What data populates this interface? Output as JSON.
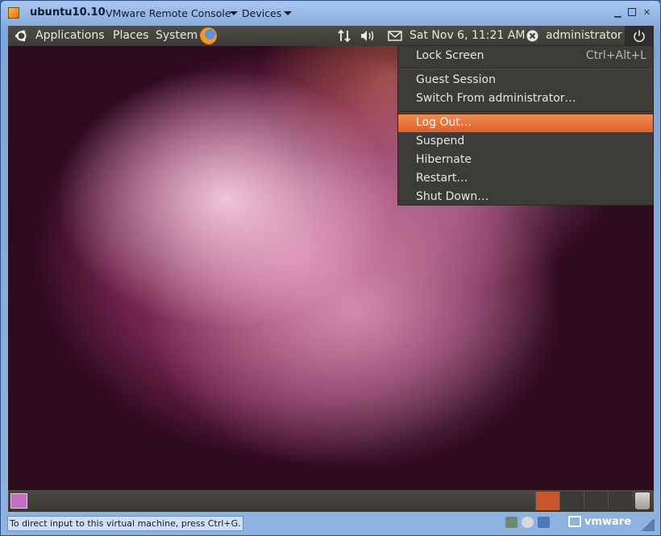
{
  "window": {
    "title": "ubuntu10.10",
    "menus": [
      "VMware Remote Console",
      "Devices"
    ],
    "controls": [
      "minimize",
      "maximize",
      "close"
    ]
  },
  "top_panel": {
    "menus": [
      "Applications",
      "Places",
      "System"
    ],
    "clock": "Sat Nov 6, 11:21 AM",
    "user": "administrator",
    "icons": [
      "ubuntu-logo-icon",
      "firefox-icon",
      "network-icon",
      "volume-icon",
      "mail-icon",
      "user-status-icon",
      "power-icon"
    ]
  },
  "session_menu": {
    "lock": {
      "label": "Lock Screen",
      "shortcut": "Ctrl+Alt+L"
    },
    "guest": "Guest Session",
    "switch": "Switch From administrator…",
    "logout": "Log Out…",
    "suspend": "Suspend",
    "hibernate": "Hibernate",
    "restart": "Restart…",
    "shutdown": "Shut Down…",
    "highlighted": "Log Out…"
  },
  "bottom_panel": {
    "workspaces": 4,
    "active_workspace": 1
  },
  "statusbar": {
    "message": "To direct input to this virtual machine, press Ctrl+G.",
    "brand": "vmware"
  },
  "colors": {
    "accent": "#e0602a",
    "panel": "#3c3b37",
    "vmware_frame": "#8fb2e0"
  }
}
